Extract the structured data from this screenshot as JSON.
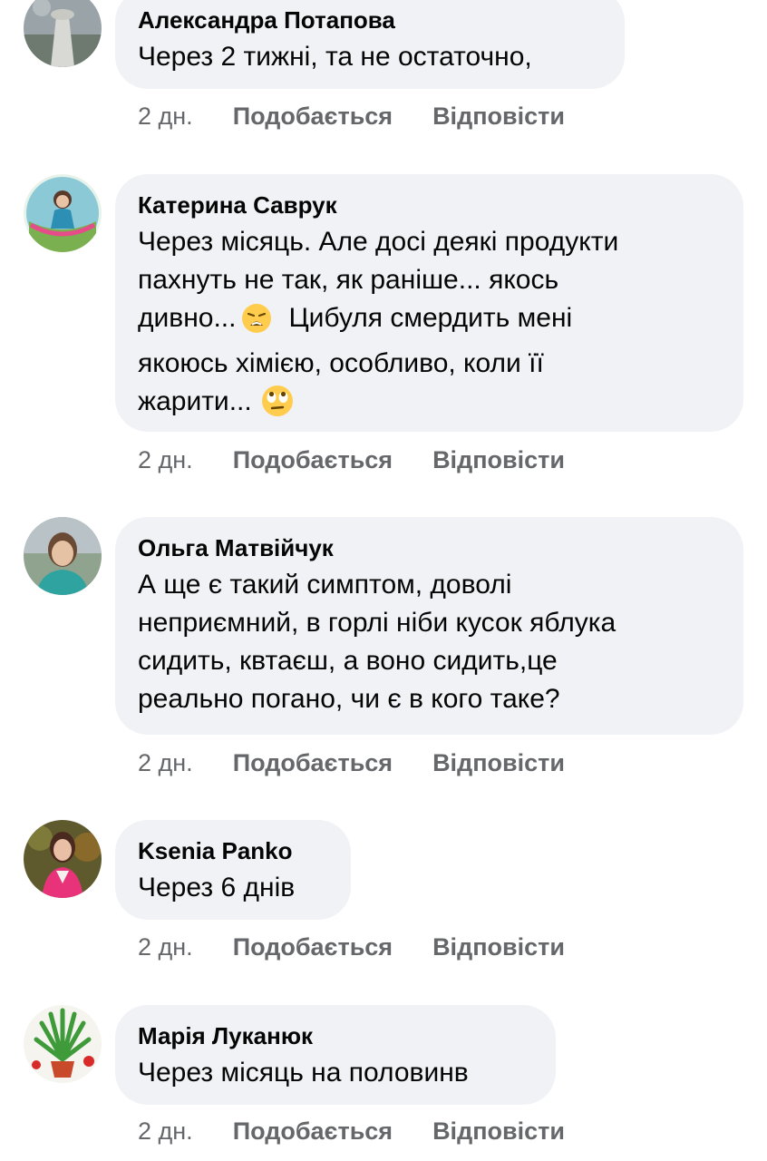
{
  "comments": [
    {
      "author": "Александра Потапова",
      "lines": [
        "Через 2 тижні, та не остаточно,"
      ],
      "time": "2 дн.",
      "like": "Подобається",
      "reply": "Відповісти"
    },
    {
      "author": "Катерина Саврук",
      "lines": [
        "Через місяць. Але досі деякі продукти",
        "пахнуть не так, як раніше... якось",
        "дивно...",
        "Цибуля смердить мені",
        "якоюсь хімією, особливо, коли її",
        "жарити..."
      ],
      "emoji": [
        "weary-face",
        "rolling-eyes-face"
      ],
      "time": "2 дн.",
      "like": "Подобається",
      "reply": "Відповісти"
    },
    {
      "author": "Ольга Матвійчук",
      "lines": [
        "А ще є такий симптом, доволі",
        "неприємний, в горлі ніби кусок яблука",
        "сидить, квтаєш, а воно сидить,це",
        "реально погано, чи є в кого таке?"
      ],
      "time": "2 дн.",
      "like": "Подобається",
      "reply": "Відповісти"
    },
    {
      "author": "Ksenia Panko",
      "lines": [
        "Через 6 днів"
      ],
      "time": "2 дн.",
      "like": "Подобається",
      "reply": "Відповісти"
    },
    {
      "author": "Марія Луканюк",
      "lines": [
        "Через місяць на половинв"
      ],
      "time": "2 дн.",
      "like": "Подобається",
      "reply": "Відповісти"
    }
  ],
  "colors": {
    "bubble": "#f0f2f5",
    "meta": "#65676b",
    "text": "#050505"
  }
}
